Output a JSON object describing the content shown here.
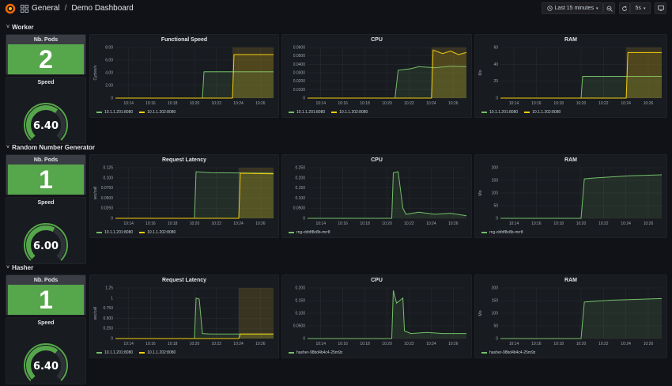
{
  "header": {
    "folder": "General",
    "separator": "/",
    "dashboard": "Demo Dashboard",
    "time_range": "Last 15 minutes",
    "refresh": "5s"
  },
  "colors": {
    "green": "#56a64b",
    "series1": "#73bf69",
    "series2": "#f2cc0c",
    "panel": "#181b1f",
    "stat_bg": "#3a3e44"
  },
  "x_ticks": [
    "10:14",
    "10:16",
    "10:18",
    "10:20",
    "10:22",
    "10:24",
    "10:26"
  ],
  "rows": [
    {
      "title": "Worker",
      "pods_title": "Nb. Pods",
      "pods": "2",
      "speed_title": "Speed",
      "speed": "6.40",
      "speed_fraction": 0.64,
      "graphs": [
        {
          "title": "Functional Speed",
          "ylabel": "Cycles/s",
          "yticks": [
            "8.00",
            "6.00",
            "4.00",
            "2.00",
            "0"
          ],
          "legend": [
            "10.1.1.201:8080",
            "10.1.1.202:8080"
          ]
        },
        {
          "title": "CPU",
          "ylabel": "",
          "yticks": [
            "0.0600",
            "0.0500",
            "0.0400",
            "0.0300",
            "0.0200",
            "0.0100",
            "0"
          ],
          "legend": [
            "10.1.1.201:8080",
            "10.1.1.202:8080"
          ]
        },
        {
          "title": "RAM",
          "ylabel": "Mo",
          "yticks": [
            "60",
            "40",
            "20",
            "0"
          ],
          "legend": [
            "10.1.1.201:8080",
            "10.1.1.202:8080"
          ]
        }
      ]
    },
    {
      "title": "Random Number Generator",
      "pods_title": "Nb. Pods",
      "pods": "1",
      "speed_title": "Speed",
      "speed": "6.00",
      "speed_fraction": 0.6,
      "graphs": [
        {
          "title": "Request Latency",
          "ylabel": "sec/call",
          "yticks": [
            "0.125",
            "0.100",
            "0.0750",
            "0.0500",
            "0.0250",
            "0"
          ],
          "legend": [
            "10.1.1.201:8080",
            "10.1.1.202:8080"
          ]
        },
        {
          "title": "CPU",
          "ylabel": "",
          "yticks": [
            "0.250",
            "0.200",
            "0.150",
            "0.100",
            "0.0500",
            "0"
          ],
          "legend": [
            "rng-cbfdf8c8b-mrr8"
          ]
        },
        {
          "title": "RAM",
          "ylabel": "Mo",
          "yticks": [
            "200",
            "150",
            "100",
            "50",
            "0"
          ],
          "legend": [
            "rng-cbfdf8c8b-mrr8"
          ]
        }
      ]
    },
    {
      "title": "Hasher",
      "pods_title": "Nb. Pods",
      "pods": "1",
      "speed_title": "Speed",
      "speed": "6.40",
      "speed_fraction": 0.64,
      "graphs": [
        {
          "title": "Request Latency",
          "ylabel": "sec/call",
          "yticks": [
            "1.25",
            "1",
            "0.750",
            "0.500",
            "0.250",
            "0"
          ],
          "legend": [
            "10.1.1.201:8080",
            "10.1.1.202:8080"
          ]
        },
        {
          "title": "CPU",
          "ylabel": "",
          "yticks": [
            "0.200",
            "0.150",
            "0.100",
            "0.0500",
            "0"
          ],
          "legend": [
            "hasher-98bd4b4c4-25m9z"
          ]
        },
        {
          "title": "RAM",
          "ylabel": "Mo",
          "yticks": [
            "200",
            "150",
            "100",
            "50",
            "0"
          ],
          "legend": [
            "hasher-98bd4b4c4-25m9z"
          ]
        }
      ]
    }
  ]
}
